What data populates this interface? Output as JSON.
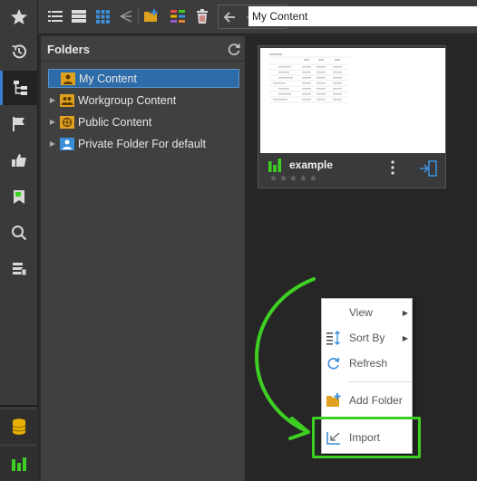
{
  "toolbar": {
    "path_value": "My Content"
  },
  "folders": {
    "title": "Folders",
    "items": [
      {
        "label": "My Content"
      },
      {
        "label": "Workgroup Content"
      },
      {
        "label": "Public Content"
      },
      {
        "label": "Private Folder For default"
      }
    ]
  },
  "card": {
    "name": "example",
    "rating_stars": "★★★★★",
    "rating": 0
  },
  "context_menu": {
    "items": [
      {
        "label": "View"
      },
      {
        "label": "Sort By"
      },
      {
        "label": "Refresh"
      },
      {
        "label": "Add Folder"
      },
      {
        "label": "Import"
      }
    ]
  },
  "colors": {
    "selection": "#2d6ca8",
    "accent_green": "#3ecf23",
    "rail_active": "#3b7ecf"
  }
}
